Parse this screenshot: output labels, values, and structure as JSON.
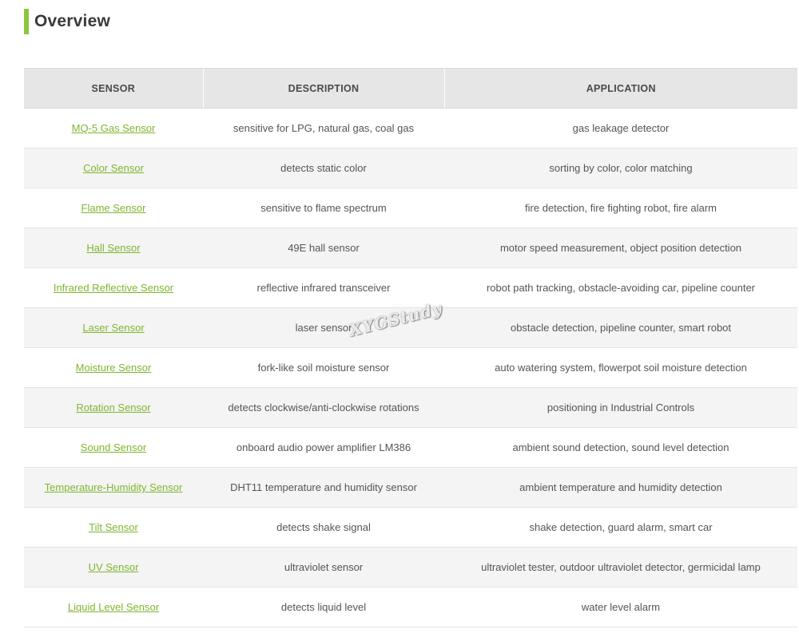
{
  "section": {
    "title": "Overview",
    "accent_color": "#8cc63f"
  },
  "table": {
    "headers": [
      "SENSOR",
      "DESCRIPTION",
      "APPLICATION"
    ],
    "rows": [
      {
        "sensor": "MQ-5 Gas Sensor",
        "description": "sensitive for LPG, natural gas, coal gas",
        "application": "gas leakage detector"
      },
      {
        "sensor": "Color Sensor",
        "description": "detects static color",
        "application": "sorting by color, color matching"
      },
      {
        "sensor": "Flame Sensor",
        "description": "sensitive to flame spectrum",
        "application": "fire detection, fire fighting robot, fire alarm"
      },
      {
        "sensor": "Hall Sensor",
        "description": "49E hall sensor",
        "application": "motor speed measurement, object position detection"
      },
      {
        "sensor": "Infrared Reflective Sensor",
        "description": "reflective infrared transceiver",
        "application": "robot path tracking, obstacle-avoiding car, pipeline counter"
      },
      {
        "sensor": "Laser Sensor",
        "description": "laser sensor",
        "application": "obstacle detection, pipeline counter, smart robot"
      },
      {
        "sensor": "Moisture Sensor",
        "description": "fork-like soil moisture sensor",
        "application": "auto watering system, flowerpot soil moisture detection"
      },
      {
        "sensor": "Rotation Sensor",
        "description": "detects clockwise/anti-clockwise rotations",
        "application": "positioning in Industrial Controls"
      },
      {
        "sensor": "Sound Sensor",
        "description": "onboard audio power amplifier LM386",
        "application": "ambient sound detection, sound level detection"
      },
      {
        "sensor": "Temperature-Humidity Sensor",
        "description": "DHT11 temperature and humidity sensor",
        "application": "ambient temperature and humidity detection"
      },
      {
        "sensor": "Tilt Sensor",
        "description": "detects shake signal",
        "application": "shake detection, guard alarm, smart car"
      },
      {
        "sensor": "UV Sensor",
        "description": "ultraviolet sensor",
        "application": "ultraviolet tester, outdoor ultraviolet detector, germicidal lamp"
      },
      {
        "sensor": "Liquid Level Sensor",
        "description": "detects liquid level",
        "application": "water level alarm"
      }
    ],
    "link_color": "#7fb62e",
    "header_bg": "#e6e6e6",
    "alt_row_bg": "#f4f4f4"
  },
  "watermark": {
    "text": "XYGStudy"
  }
}
